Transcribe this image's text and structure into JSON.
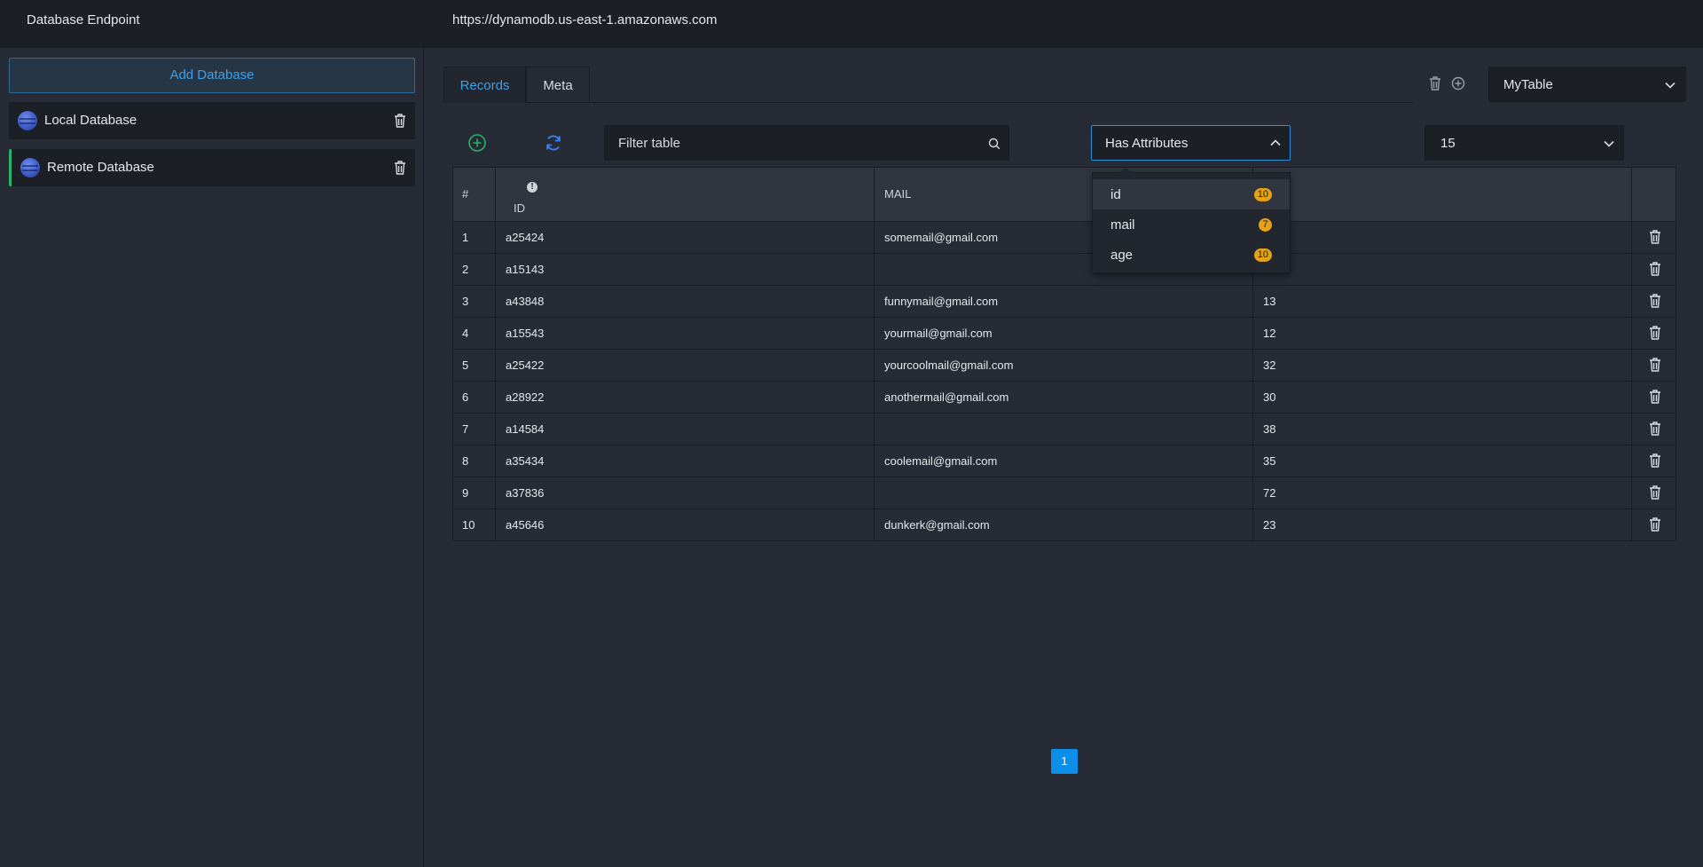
{
  "topbar": {
    "title": "Database Endpoint",
    "endpoint": "https://dynamodb.us-east-1.amazonaws.com"
  },
  "sidebar": {
    "add_label": "Add Database",
    "items": [
      {
        "label": "Local Database",
        "icon": "database-icon"
      },
      {
        "label": "Remote Database",
        "icon": "database-icon"
      }
    ]
  },
  "tabs": [
    {
      "label": "Records"
    },
    {
      "label": "Meta"
    }
  ],
  "table_selector": {
    "value": "MyTable"
  },
  "filter": {
    "placeholder": "Filter table"
  },
  "attribute_filter": {
    "value": "Has Attributes",
    "options": [
      {
        "name": "id",
        "count": "10"
      },
      {
        "name": "mail",
        "count": "7"
      },
      {
        "name": "age",
        "count": "10"
      }
    ]
  },
  "page_size": {
    "value": "15"
  },
  "grid": {
    "headers": [
      "#",
      "ID",
      "MAIL",
      ""
    ],
    "rows": [
      [
        "1",
        "a25424",
        "somemail@gmail.com",
        ""
      ],
      [
        "2",
        "a15143",
        "",
        ""
      ],
      [
        "3",
        "a43848",
        "funnymail@gmail.com",
        "13"
      ],
      [
        "4",
        "a15543",
        "yourmail@gmail.com",
        "12"
      ],
      [
        "5",
        "a25422",
        "yourcoolmail@gmail.com",
        "32"
      ],
      [
        "6",
        "a28922",
        "anothermail@gmail.com",
        "30"
      ],
      [
        "7",
        "a14584",
        "",
        "38"
      ],
      [
        "8",
        "a35434",
        "coolemail@gmail.com",
        "35"
      ],
      [
        "9",
        "a37836",
        "",
        "72"
      ],
      [
        "10",
        "a45646",
        "dunkerk@gmail.com",
        "23"
      ]
    ]
  },
  "pagination": {
    "current": "1"
  },
  "colors": {
    "accent": "#3fa0e6",
    "active_indicator": "#27b36b",
    "badge": "#e3a21a",
    "page_button": "#0b8fe8"
  }
}
